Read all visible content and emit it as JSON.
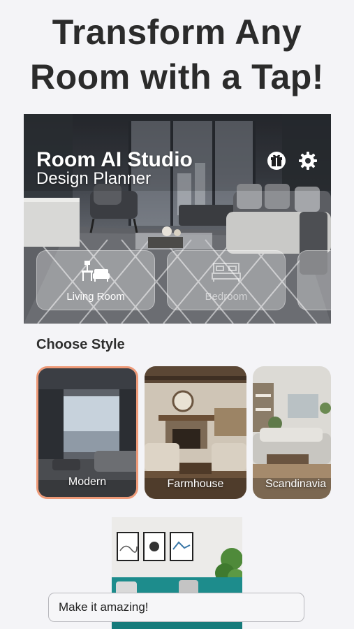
{
  "headline": {
    "line1": "Transform Any",
    "line2": "Room with a Tap!"
  },
  "hero": {
    "title": "Room AI Studio",
    "subtitle": "Design Planner",
    "icons": [
      "gift-icon",
      "gear-icon"
    ],
    "rooms": [
      {
        "label": "Living Room",
        "icon": "living-room-icon",
        "state": "selected"
      },
      {
        "label": "Bedroom",
        "icon": "bed-icon",
        "state": "dimmed"
      }
    ]
  },
  "styles": {
    "title": "Choose Style",
    "items": [
      {
        "label": "Modern",
        "selected": true
      },
      {
        "label": "Farmhouse",
        "selected": false
      },
      {
        "label": "Scandinavia",
        "selected": false
      }
    ]
  },
  "prompt": {
    "value": "Make it amazing!"
  },
  "colors": {
    "accent": "#ee9a78",
    "background": "#f4f4f7"
  }
}
